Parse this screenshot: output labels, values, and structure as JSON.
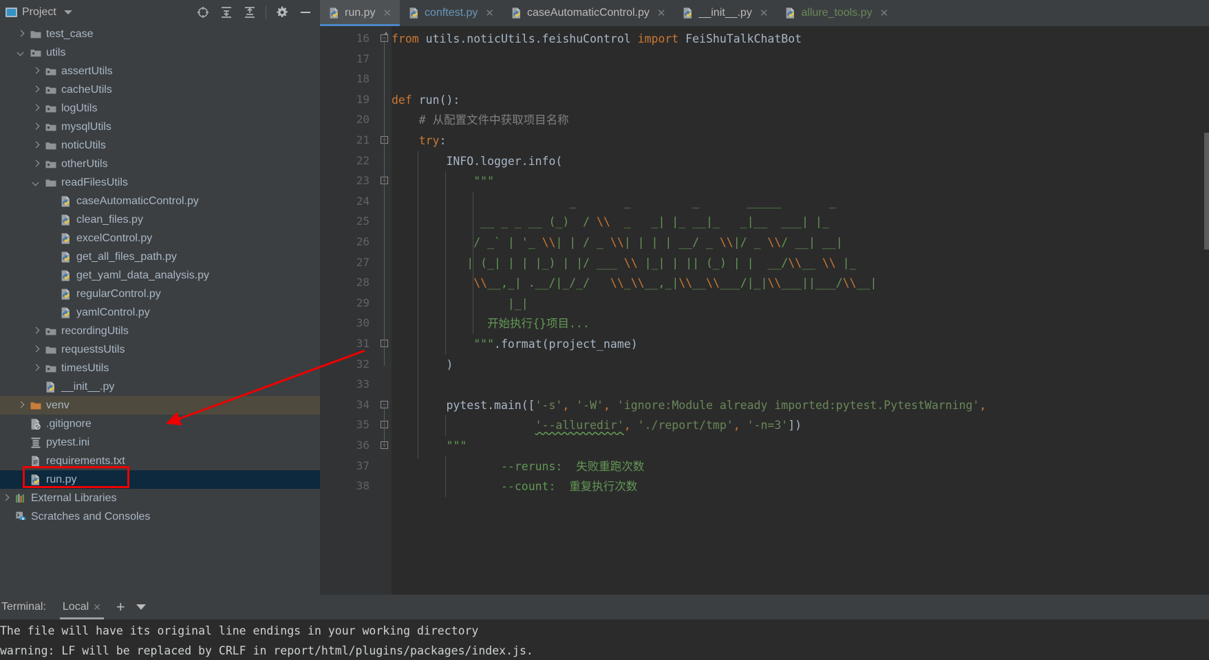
{
  "window": {
    "theme_bg": "#3c3f41",
    "editor_bg": "#2b2b2b",
    "accent": "#4a88c7",
    "annotation_color": "#ee0000"
  },
  "project_panel": {
    "title": "Project",
    "title_icon": "project-window-icon",
    "dropdown_icon": "chevron-down-icon",
    "toolbar": [
      {
        "name": "locate-target-icon",
        "label": "Select Opened File"
      },
      {
        "name": "expand-all-icon",
        "label": "Expand All"
      },
      {
        "name": "collapse-all-icon",
        "label": "Collapse All"
      },
      {
        "name": "gear-icon",
        "label": "Settings"
      },
      {
        "name": "minimize-icon",
        "label": "Hide"
      }
    ],
    "tree": [
      {
        "label": "test_case",
        "indent": 1,
        "arrow": "closed",
        "icon": "folder-icon",
        "state": "normal"
      },
      {
        "label": "utils",
        "indent": 1,
        "arrow": "open",
        "icon": "folder-source-icon",
        "state": "normal"
      },
      {
        "label": "assertUtils",
        "indent": 2,
        "arrow": "closed",
        "icon": "folder-source-icon",
        "state": "normal"
      },
      {
        "label": "cacheUtils",
        "indent": 2,
        "arrow": "closed",
        "icon": "folder-source-icon",
        "state": "normal"
      },
      {
        "label": "logUtils",
        "indent": 2,
        "arrow": "closed",
        "icon": "folder-source-icon",
        "state": "normal"
      },
      {
        "label": "mysqlUtils",
        "indent": 2,
        "arrow": "closed",
        "icon": "folder-source-icon",
        "state": "normal"
      },
      {
        "label": "noticUtils",
        "indent": 2,
        "arrow": "closed",
        "icon": "folder-icon",
        "state": "normal"
      },
      {
        "label": "otherUtils",
        "indent": 2,
        "arrow": "closed",
        "icon": "folder-source-icon",
        "state": "normal"
      },
      {
        "label": "readFilesUtils",
        "indent": 2,
        "arrow": "open",
        "icon": "folder-icon",
        "state": "normal"
      },
      {
        "label": "caseAutomaticControl.py",
        "indent": 3,
        "arrow": "none",
        "icon": "python-file-icon",
        "state": "normal"
      },
      {
        "label": "clean_files.py",
        "indent": 3,
        "arrow": "none",
        "icon": "python-file-icon",
        "state": "normal"
      },
      {
        "label": "excelControl.py",
        "indent": 3,
        "arrow": "none",
        "icon": "python-file-icon",
        "state": "normal"
      },
      {
        "label": "get_all_files_path.py",
        "indent": 3,
        "arrow": "none",
        "icon": "python-file-icon",
        "state": "normal"
      },
      {
        "label": "get_yaml_data_analysis.py",
        "indent": 3,
        "arrow": "none",
        "icon": "python-file-icon",
        "state": "normal"
      },
      {
        "label": "regularControl.py",
        "indent": 3,
        "arrow": "none",
        "icon": "python-file-icon",
        "state": "normal"
      },
      {
        "label": "yamlControl.py",
        "indent": 3,
        "arrow": "none",
        "icon": "python-file-icon",
        "state": "normal"
      },
      {
        "label": "recordingUtils",
        "indent": 2,
        "arrow": "closed",
        "icon": "folder-source-icon",
        "state": "normal"
      },
      {
        "label": "requestsUtils",
        "indent": 2,
        "arrow": "closed",
        "icon": "folder-icon",
        "state": "normal"
      },
      {
        "label": "timesUtils",
        "indent": 2,
        "arrow": "closed",
        "icon": "folder-source-icon",
        "state": "normal"
      },
      {
        "label": "__init__.py",
        "indent": 2,
        "arrow": "none",
        "icon": "python-file-icon",
        "state": "normal"
      },
      {
        "label": "venv",
        "indent": 1,
        "arrow": "closed",
        "icon": "folder-excluded-icon",
        "state": "highlight"
      },
      {
        "label": ".gitignore",
        "indent": 1,
        "arrow": "none",
        "icon": "gitignore-file-icon",
        "state": "normal"
      },
      {
        "label": "pytest.ini",
        "indent": 1,
        "arrow": "none",
        "icon": "ini-file-icon",
        "state": "normal"
      },
      {
        "label": "requirements.txt",
        "indent": 1,
        "arrow": "none",
        "icon": "text-file-icon",
        "state": "normal"
      },
      {
        "label": "run.py",
        "indent": 1,
        "arrow": "none",
        "icon": "python-file-icon",
        "state": "selected"
      },
      {
        "label": "External Libraries",
        "indent": 0,
        "arrow": "closed",
        "icon": "libraries-icon",
        "state": "normal"
      },
      {
        "label": "Scratches and Consoles",
        "indent": 0,
        "arrow": "none",
        "icon": "scratches-icon",
        "state": "normal"
      }
    ]
  },
  "editor": {
    "tabs": [
      {
        "label": "run.py",
        "color": "plain",
        "active": true,
        "icon": "python-file-icon",
        "close_icon": "close-icon"
      },
      {
        "label": "conftest.py",
        "color": "blue",
        "active": false,
        "icon": "python-file-icon",
        "close_icon": "close-icon"
      },
      {
        "label": "caseAutomaticControl.py",
        "color": "plain",
        "active": false,
        "icon": "python-file-icon",
        "close_icon": "close-icon"
      },
      {
        "label": "__init__.py",
        "color": "plain",
        "active": false,
        "icon": "python-file-icon",
        "close_icon": "close-icon"
      },
      {
        "label": "allure_tools.py",
        "color": "green",
        "active": false,
        "icon": "python-file-icon",
        "close_icon": "close-icon"
      }
    ],
    "first_line_number": 16,
    "line_numbers": [
      16,
      17,
      18,
      19,
      20,
      21,
      22,
      23,
      24,
      25,
      26,
      27,
      28,
      29,
      30,
      31,
      32,
      33,
      34,
      35,
      36,
      37,
      38
    ],
    "code_lines": [
      {
        "n": 16,
        "html": "<span class=\"kw\">from</span> utils.noticUtils.feishuControl <span class=\"kw\">import</span> FeiShuTalkChatBot"
      },
      {
        "n": 17,
        "html": ""
      },
      {
        "n": 18,
        "html": ""
      },
      {
        "n": 19,
        "html": "<span class=\"kw\">def</span> <span class=\"fn\">run</span>():"
      },
      {
        "n": 20,
        "html": "    <span class=\"cmt\"># 从配置文件中获取项目名称</span>"
      },
      {
        "n": 21,
        "html": "    <span class=\"kw\">try</span>:"
      },
      {
        "n": 22,
        "html": "        INFO.logger.info("
      },
      {
        "n": 23,
        "html": "            <span class=\"doc\">\"\"\"</span>"
      },
      {
        "n": 24,
        "html": "                          <span class=\"doc\">_       _         _       _____       _</span>"
      },
      {
        "n": 25,
        "html": "             <span class=\"doc\">__ _ _ __ (_)  / </span><span class=\"docbr\">\\\\</span><span class=\"doc\">  _   _| |_ __|_   _|__  ___| |_</span>"
      },
      {
        "n": 26,
        "html": "            <span class=\"doc\">/ _` | '_ </span><span class=\"docbr\">\\\\</span><span class=\"doc\">| | / _ </span><span class=\"docbr\">\\\\</span><span class=\"doc\">| | | | __/ _ </span><span class=\"docbr\">\\\\</span><span class=\"doc\">|/ _ </span><span class=\"docbr\">\\\\</span><span class=\"doc\">/ __| __|</span>"
      },
      {
        "n": 27,
        "html": "           <span class=\"doc\">| (_| | | |_) | |/ ___ </span><span class=\"docbr\">\\\\</span><span class=\"doc\"> |_| | || (_) | |  __/</span><span class=\"docbr\">\\\\</span><span class=\"doc\">__ </span><span class=\"docbr\">\\\\</span><span class=\"doc\"> |_</span>"
      },
      {
        "n": 28,
        "html": "            <span class=\"docbr\">\\\\</span><span class=\"doc\">__,_| .__/|_/_/   </span><span class=\"docbr\">\\\\</span><span class=\"doc\">_</span><span class=\"docbr\">\\\\</span><span class=\"doc\">__,_|</span><span class=\"docbr\">\\\\</span><span class=\"doc\">__</span><span class=\"docbr\">\\\\</span><span class=\"doc\">___/|_|</span><span class=\"docbr\">\\\\</span><span class=\"doc\">___||___/</span><span class=\"docbr\">\\\\</span><span class=\"doc\">__|</span>"
      },
      {
        "n": 29,
        "html": "                 <span class=\"doc\">|_|</span>"
      },
      {
        "n": 30,
        "html": "              <span class=\"doc\">开始执行{}项目...</span>"
      },
      {
        "n": 31,
        "html": "            <span class=\"doc\">\"\"\"</span>.format(project_name)"
      },
      {
        "n": 32,
        "html": "        )"
      },
      {
        "n": 33,
        "html": ""
      },
      {
        "n": 34,
        "html": "        pytest.main([<span class=\"str\">'-s'</span><span class=\"kw\">,</span> <span class=\"str\">'-W'</span><span class=\"kw\">,</span> <span class=\"str\">'ignore:Module already imported:pytest.PytestWarning'</span><span class=\"kw\">,</span>"
      },
      {
        "n": 35,
        "html": "                     <span class=\"str\"><span class=\"typo\">'--alluredir'</span></span><span class=\"kw\">,</span> <span class=\"str\">'./report/tmp'</span><span class=\"kw\">,</span> <span class=\"str\">'-n=3'</span>])"
      },
      {
        "n": 36,
        "html": "        <span class=\"doc\">\"\"\"</span>"
      },
      {
        "n": 37,
        "html": "                <span class=\"doc\">--reruns:  失败重跑次数</span>"
      },
      {
        "n": 38,
        "html": "                <span class=\"doc\">--count:  重复执行次数</span>"
      }
    ],
    "code_text": [
      "from utils.noticUtils.feishuControl import FeiShuTalkChatBot",
      "",
      "",
      "def run():",
      "    # 从配置文件中获取项目名称",
      "    try:",
      "        INFO.logger.info(",
      "            \"\"\"",
      "                          _       _         _       _____       _",
      "             __ _ _ __ (_)  / \\\\  _   _| |_ __|_   _|__  ___| |_",
      "            / _` | '_ \\\\| | / _ \\\\| | | | __/ _ \\\\|/ _ \\\\/ __| __|",
      "           | (_| | | |_) | |/ ___ \\\\ |_| | || (_) | |  __/\\\\__ \\\\ |_",
      "            \\\\__,_| .__/|_/_/   \\\\_\\\\__,_|\\\\__\\\\___/|_|\\\\___||___/\\\\__|",
      "                 |_|",
      "              开始执行{}项目...",
      "            \"\"\".format(project_name)",
      "        )",
      "",
      "        pytest.main(['-s', '-W', 'ignore:Module already imported:pytest.PytestWarning',",
      "                     '--alluredir', './report/tmp', '-n=3'])",
      "        \"\"\"",
      "                --reruns:  失败重跑次数",
      "                --count:  重复执行次数"
    ]
  },
  "terminal": {
    "label": "Terminal:",
    "tab_label": "Local",
    "tab_close_icon": "close-icon",
    "add_icon": "plus-icon",
    "dropdown_icon": "chevron-down-icon",
    "output_lines": [
      "The file will have its original line endings in your working directory",
      "warning: LF will be replaced by CRLF in report/html/plugins/packages/index.js."
    ]
  },
  "annotation": {
    "arrow_color": "#ee0000",
    "highlight_box_target": "run.py"
  }
}
